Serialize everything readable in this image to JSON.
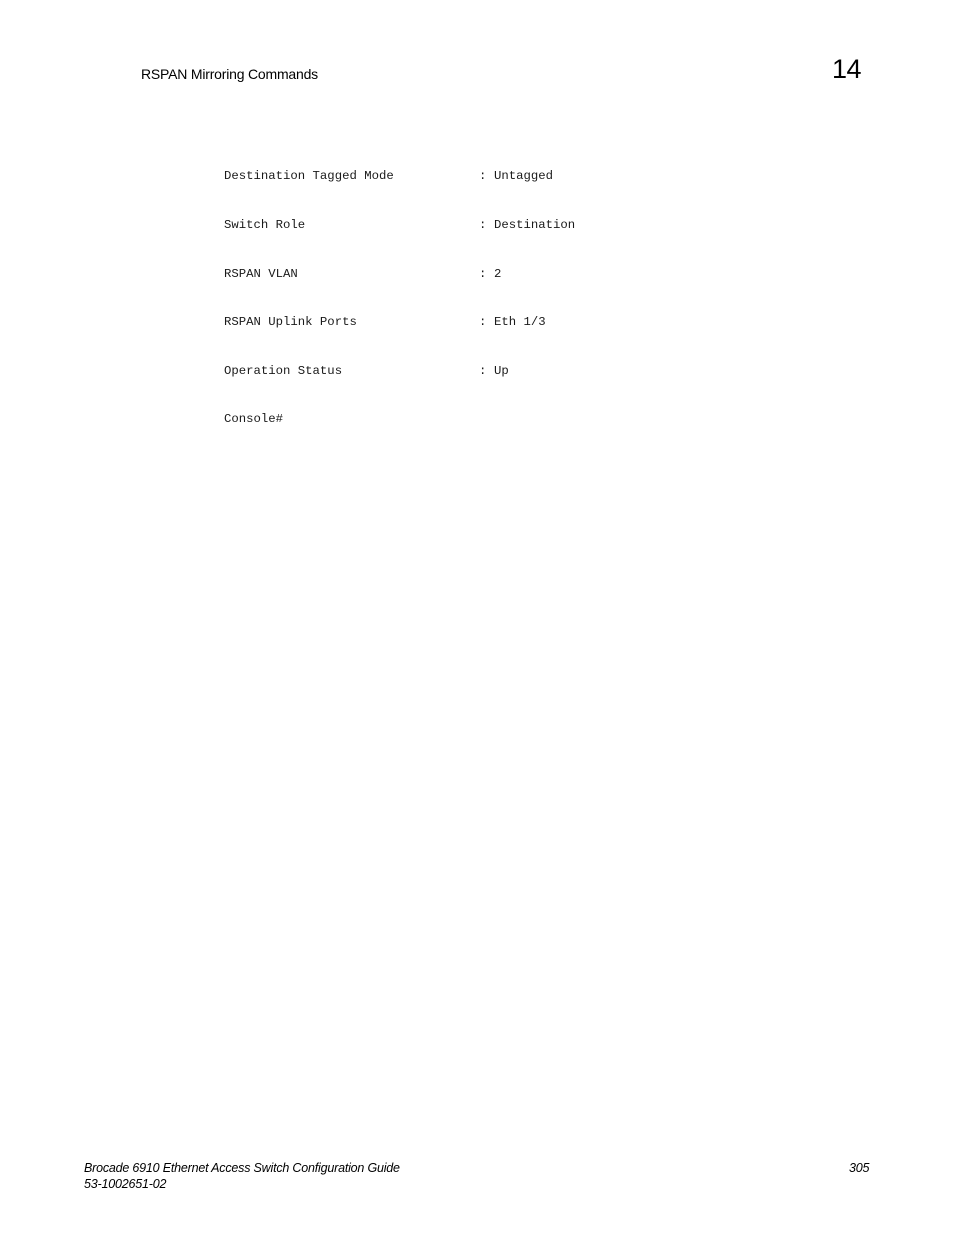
{
  "header": {
    "section_title": "RSPAN Mirroring Commands",
    "chapter_number": "14"
  },
  "code_output": {
    "rows": [
      {
        "key": "Destination Tagged Mode",
        "separator": ":",
        "value": "Untagged"
      },
      {
        "key": "Switch Role",
        "separator": ":",
        "value": "Destination"
      },
      {
        "key": "RSPAN VLAN",
        "separator": ":",
        "value": "2"
      },
      {
        "key": "RSPAN Uplink Ports",
        "separator": ":",
        "value": "Eth 1/3"
      },
      {
        "key": "Operation Status",
        "separator": ":",
        "value": "Up"
      }
    ],
    "prompt": "Console#"
  },
  "footer": {
    "document_title": "Brocade 6910 Ethernet Access Switch Configuration Guide",
    "document_number": "53-1002651-02",
    "page_number": "305"
  }
}
